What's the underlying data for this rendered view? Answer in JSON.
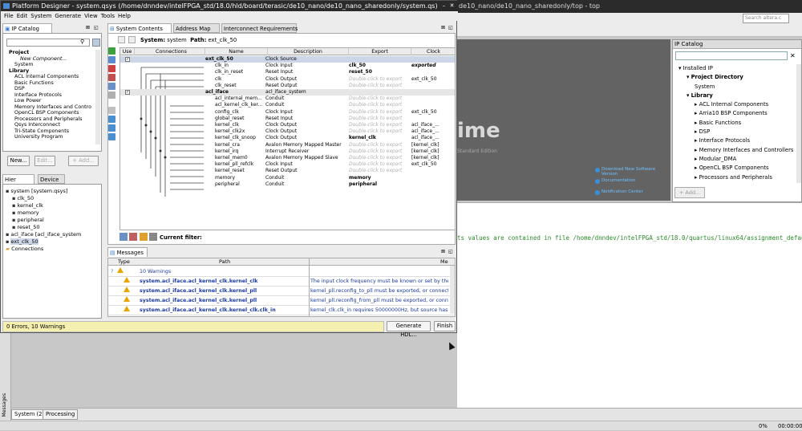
{
  "background": {
    "titlebar": "de10_nano/de10_nano_sharedonly/top - top",
    "search_placeholder": "Search altera.c",
    "splash": {
      "big_text": "ime",
      "edition": "Standard Edition",
      "links": [
        "Download New Software Version",
        "Documentation",
        "Notification Center"
      ]
    },
    "ip_catalog": {
      "title": "IP Catalog",
      "tree": [
        {
          "label": "Installed IP",
          "indent": 0,
          "bold": false
        },
        {
          "label": "Project Directory",
          "indent": 1,
          "bold": true
        },
        {
          "label": "System",
          "indent": 2,
          "bold": false
        },
        {
          "label": "Library",
          "indent": 1,
          "bold": true
        },
        {
          "label": "ACL Internal Components",
          "indent": 2,
          "bold": false
        },
        {
          "label": "Arria10 BSP Components",
          "indent": 2,
          "bold": false
        },
        {
          "label": "Basic Functions",
          "indent": 2,
          "bold": false
        },
        {
          "label": "DSP",
          "indent": 2,
          "bold": false
        },
        {
          "label": "Interface Protocols",
          "indent": 2,
          "bold": false
        },
        {
          "label": "Memory Interfaces and Controllers",
          "indent": 2,
          "bold": false
        },
        {
          "label": "Modular_DMA",
          "indent": 2,
          "bold": false
        },
        {
          "label": "OpenCL BSP Components",
          "indent": 2,
          "bold": false
        },
        {
          "label": "Processors and Peripherals",
          "indent": 2,
          "bold": false
        }
      ],
      "add_label": "+ Add..."
    },
    "message_text": "ts values are contained in file /home/dnndev/intelFPGA_std/18.0/quartus/linux64/assignment_defaults.qdf",
    "messages_vertical": "Messages",
    "bottom_tabs": [
      "System (2)",
      "Processing"
    ],
    "status_percent": "0%",
    "status_time": "00:00:00"
  },
  "window": {
    "title": "Platform Designer - system.qsys (/home/dnndev/intelFPGA_std/18.0/hld/board/terasic/de10_nano/de10_nano_sharedonly/system.qs)",
    "menu": [
      "File",
      "Edit",
      "System",
      "Generate",
      "View",
      "Tools",
      "Help"
    ],
    "ip_catalog": {
      "tab": "IP Catalog",
      "tree": [
        {
          "label": "Project",
          "indent": 0,
          "italic": false,
          "bold": true
        },
        {
          "label": "New Component...",
          "indent": 2,
          "italic": true,
          "bold": false
        },
        {
          "label": "System",
          "indent": 1,
          "italic": false,
          "bold": false
        },
        {
          "label": "Library",
          "indent": 0,
          "italic": false,
          "bold": true
        },
        {
          "label": "ACL Internal Components",
          "indent": 1,
          "italic": false,
          "bold": false
        },
        {
          "label": "Basic Functions",
          "indent": 1,
          "italic": false,
          "bold": false
        },
        {
          "label": "DSP",
          "indent": 1,
          "italic": false,
          "bold": false
        },
        {
          "label": "Interface Protocols",
          "indent": 1,
          "italic": false,
          "bold": false
        },
        {
          "label": "Low Power",
          "indent": 1,
          "italic": false,
          "bold": false
        },
        {
          "label": "Memory Interfaces and Contro",
          "indent": 1,
          "italic": false,
          "bold": false
        },
        {
          "label": "OpenCL BSP Components",
          "indent": 1,
          "italic": false,
          "bold": false
        },
        {
          "label": "Processors and Peripherals",
          "indent": 1,
          "italic": false,
          "bold": false
        },
        {
          "label": "Qsys Interconnect",
          "indent": 1,
          "italic": false,
          "bold": false
        },
        {
          "label": "Tri-State Components",
          "indent": 1,
          "italic": false,
          "bold": false
        },
        {
          "label": "University Program",
          "indent": 1,
          "italic": false,
          "bold": false
        }
      ],
      "buttons": [
        "New...",
        "Edit...",
        "+ Add..."
      ]
    },
    "hier": {
      "tabs": [
        "Hier",
        "Device"
      ],
      "tree": [
        {
          "label": "system [system.qsys]",
          "indent": 0,
          "sel": false
        },
        {
          "label": "clk_50",
          "indent": 1,
          "sel": false
        },
        {
          "label": "kernel_clk",
          "indent": 1,
          "sel": false
        },
        {
          "label": "memory",
          "indent": 1,
          "sel": false
        },
        {
          "label": "peripheral",
          "indent": 1,
          "sel": false
        },
        {
          "label": "reset_50",
          "indent": 1,
          "sel": false
        },
        {
          "label": "acl_iface [acl_iface_system",
          "indent": 0,
          "sel": false
        },
        {
          "label": "ext_clk_50",
          "indent": 0,
          "sel": true
        },
        {
          "label": "Connections",
          "indent": 0,
          "sel": false
        }
      ]
    },
    "tabs": [
      "System Contents",
      "Address Map",
      "Interconnect Requirements"
    ],
    "system_label": "System:",
    "system_name": "system",
    "path_label": "Path:",
    "path_value": "ext_clk_50",
    "columns": [
      "Use",
      "Connections",
      "Name",
      "Description",
      "Export",
      "Clock"
    ],
    "rows": [
      {
        "use": "check",
        "name": "ext_clk_50",
        "desc": "Clock Source",
        "export": "",
        "clock": "",
        "kind": "module",
        "sel": true
      },
      {
        "use": "",
        "name": "clk_in",
        "desc": "Clock Input",
        "export": "clk_50",
        "clock": "exported",
        "kind": "port",
        "sel": false
      },
      {
        "use": "",
        "name": "clk_in_reset",
        "desc": "Reset Input",
        "export": "reset_50",
        "clock": "",
        "kind": "port",
        "sel": false
      },
      {
        "use": "",
        "name": "clk",
        "desc": "Clock Output",
        "export": "Double-click to export",
        "clock": "ext_clk_50",
        "kind": "port",
        "sel": false
      },
      {
        "use": "",
        "name": "clk_reset",
        "desc": "Reset Output",
        "export": "Double-click to export",
        "clock": "",
        "kind": "port",
        "sel": false
      },
      {
        "use": "check",
        "name": "acl_iface",
        "desc": "acl_iface_system",
        "export": "",
        "clock": "",
        "kind": "module",
        "sel": false
      },
      {
        "use": "",
        "name": "acl_internal_mem...",
        "desc": "Conduit",
        "export": "Double-click to export",
        "clock": "",
        "kind": "port",
        "sel": false
      },
      {
        "use": "",
        "name": "acl_kernel_clk_ker...",
        "desc": "Conduit",
        "export": "Double-click to export",
        "clock": "",
        "kind": "port",
        "sel": false
      },
      {
        "use": "",
        "name": "config_clk",
        "desc": "Clock Input",
        "export": "Double-click to export",
        "clock": "ext_clk_50",
        "kind": "port",
        "sel": false
      },
      {
        "use": "",
        "name": "global_reset",
        "desc": "Reset Input",
        "export": "Double-click to export",
        "clock": "",
        "kind": "port",
        "sel": false
      },
      {
        "use": "",
        "name": "kernel_clk",
        "desc": "Clock Output",
        "export": "Double-click to export",
        "clock": "acl_iface_...",
        "kind": "port",
        "sel": false
      },
      {
        "use": "",
        "name": "kernel_clk2x",
        "desc": "Clock Output",
        "export": "Double-click to export",
        "clock": "acl_iface_...",
        "kind": "port",
        "sel": false
      },
      {
        "use": "",
        "name": "kernel_clk_snoop",
        "desc": "Clock Output",
        "export": "kernel_clk",
        "clock": "acl_iface_...",
        "kind": "port",
        "sel": false
      },
      {
        "use": "",
        "name": "kernel_cra",
        "desc": "Avalon Memory Mapped Master",
        "export": "Double-click to export",
        "clock": "[kernel_clk]",
        "kind": "port",
        "sel": false
      },
      {
        "use": "",
        "name": "kernel_irq",
        "desc": "Interrupt Receiver",
        "export": "Double-click to export",
        "clock": "[kernel_clk]",
        "kind": "port",
        "sel": false
      },
      {
        "use": "",
        "name": "kernel_mem0",
        "desc": "Avalon Memory Mapped Slave",
        "export": "Double-click to export",
        "clock": "[kernel_clk]",
        "kind": "port",
        "sel": false
      },
      {
        "use": "",
        "name": "kernel_pll_refclk",
        "desc": "Clock Input",
        "export": "Double-click to export",
        "clock": "ext_clk_50",
        "kind": "port",
        "sel": false
      },
      {
        "use": "",
        "name": "kernel_reset",
        "desc": "Reset Output",
        "export": "Double-click to export",
        "clock": "",
        "kind": "port",
        "sel": false
      },
      {
        "use": "",
        "name": "memory",
        "desc": "Conduit",
        "export": "memory",
        "clock": "",
        "kind": "port",
        "sel": false
      },
      {
        "use": "",
        "name": "peripheral",
        "desc": "Conduit",
        "export": "peripheral",
        "clock": "",
        "kind": "port",
        "sel": false
      }
    ],
    "filter_label": "Current filter:",
    "messages": {
      "tab": "Messages",
      "columns": [
        "Type",
        "Path",
        "Me"
      ],
      "summary": "10 Warnings",
      "rows": [
        {
          "path": "system.acl_iface.acl_kernel_clk.kernel_clk",
          "msg": "The input clock frequency must be known or set by the pa"
        },
        {
          "path": "system.acl_iface.acl_kernel_clk.kernel_pll",
          "msg": "kernel_pll.reconfig_to_pll must be exported, or connect"
        },
        {
          "path": "system.acl_iface.acl_kernel_clk.kernel_pll",
          "msg": "kernel_pll.reconfig_from_pll must be exported, or connec"
        },
        {
          "path": "system.acl_iface.acl_kernel_clk.kernel_clk.clk_in",
          "msg": "kernel_clk.clk_in requires 50000000Hz, but source has"
        }
      ]
    },
    "status": "0 Errors, 10 Warnings",
    "generate_label": "Generate HDL...",
    "finish_label": "Finish"
  }
}
